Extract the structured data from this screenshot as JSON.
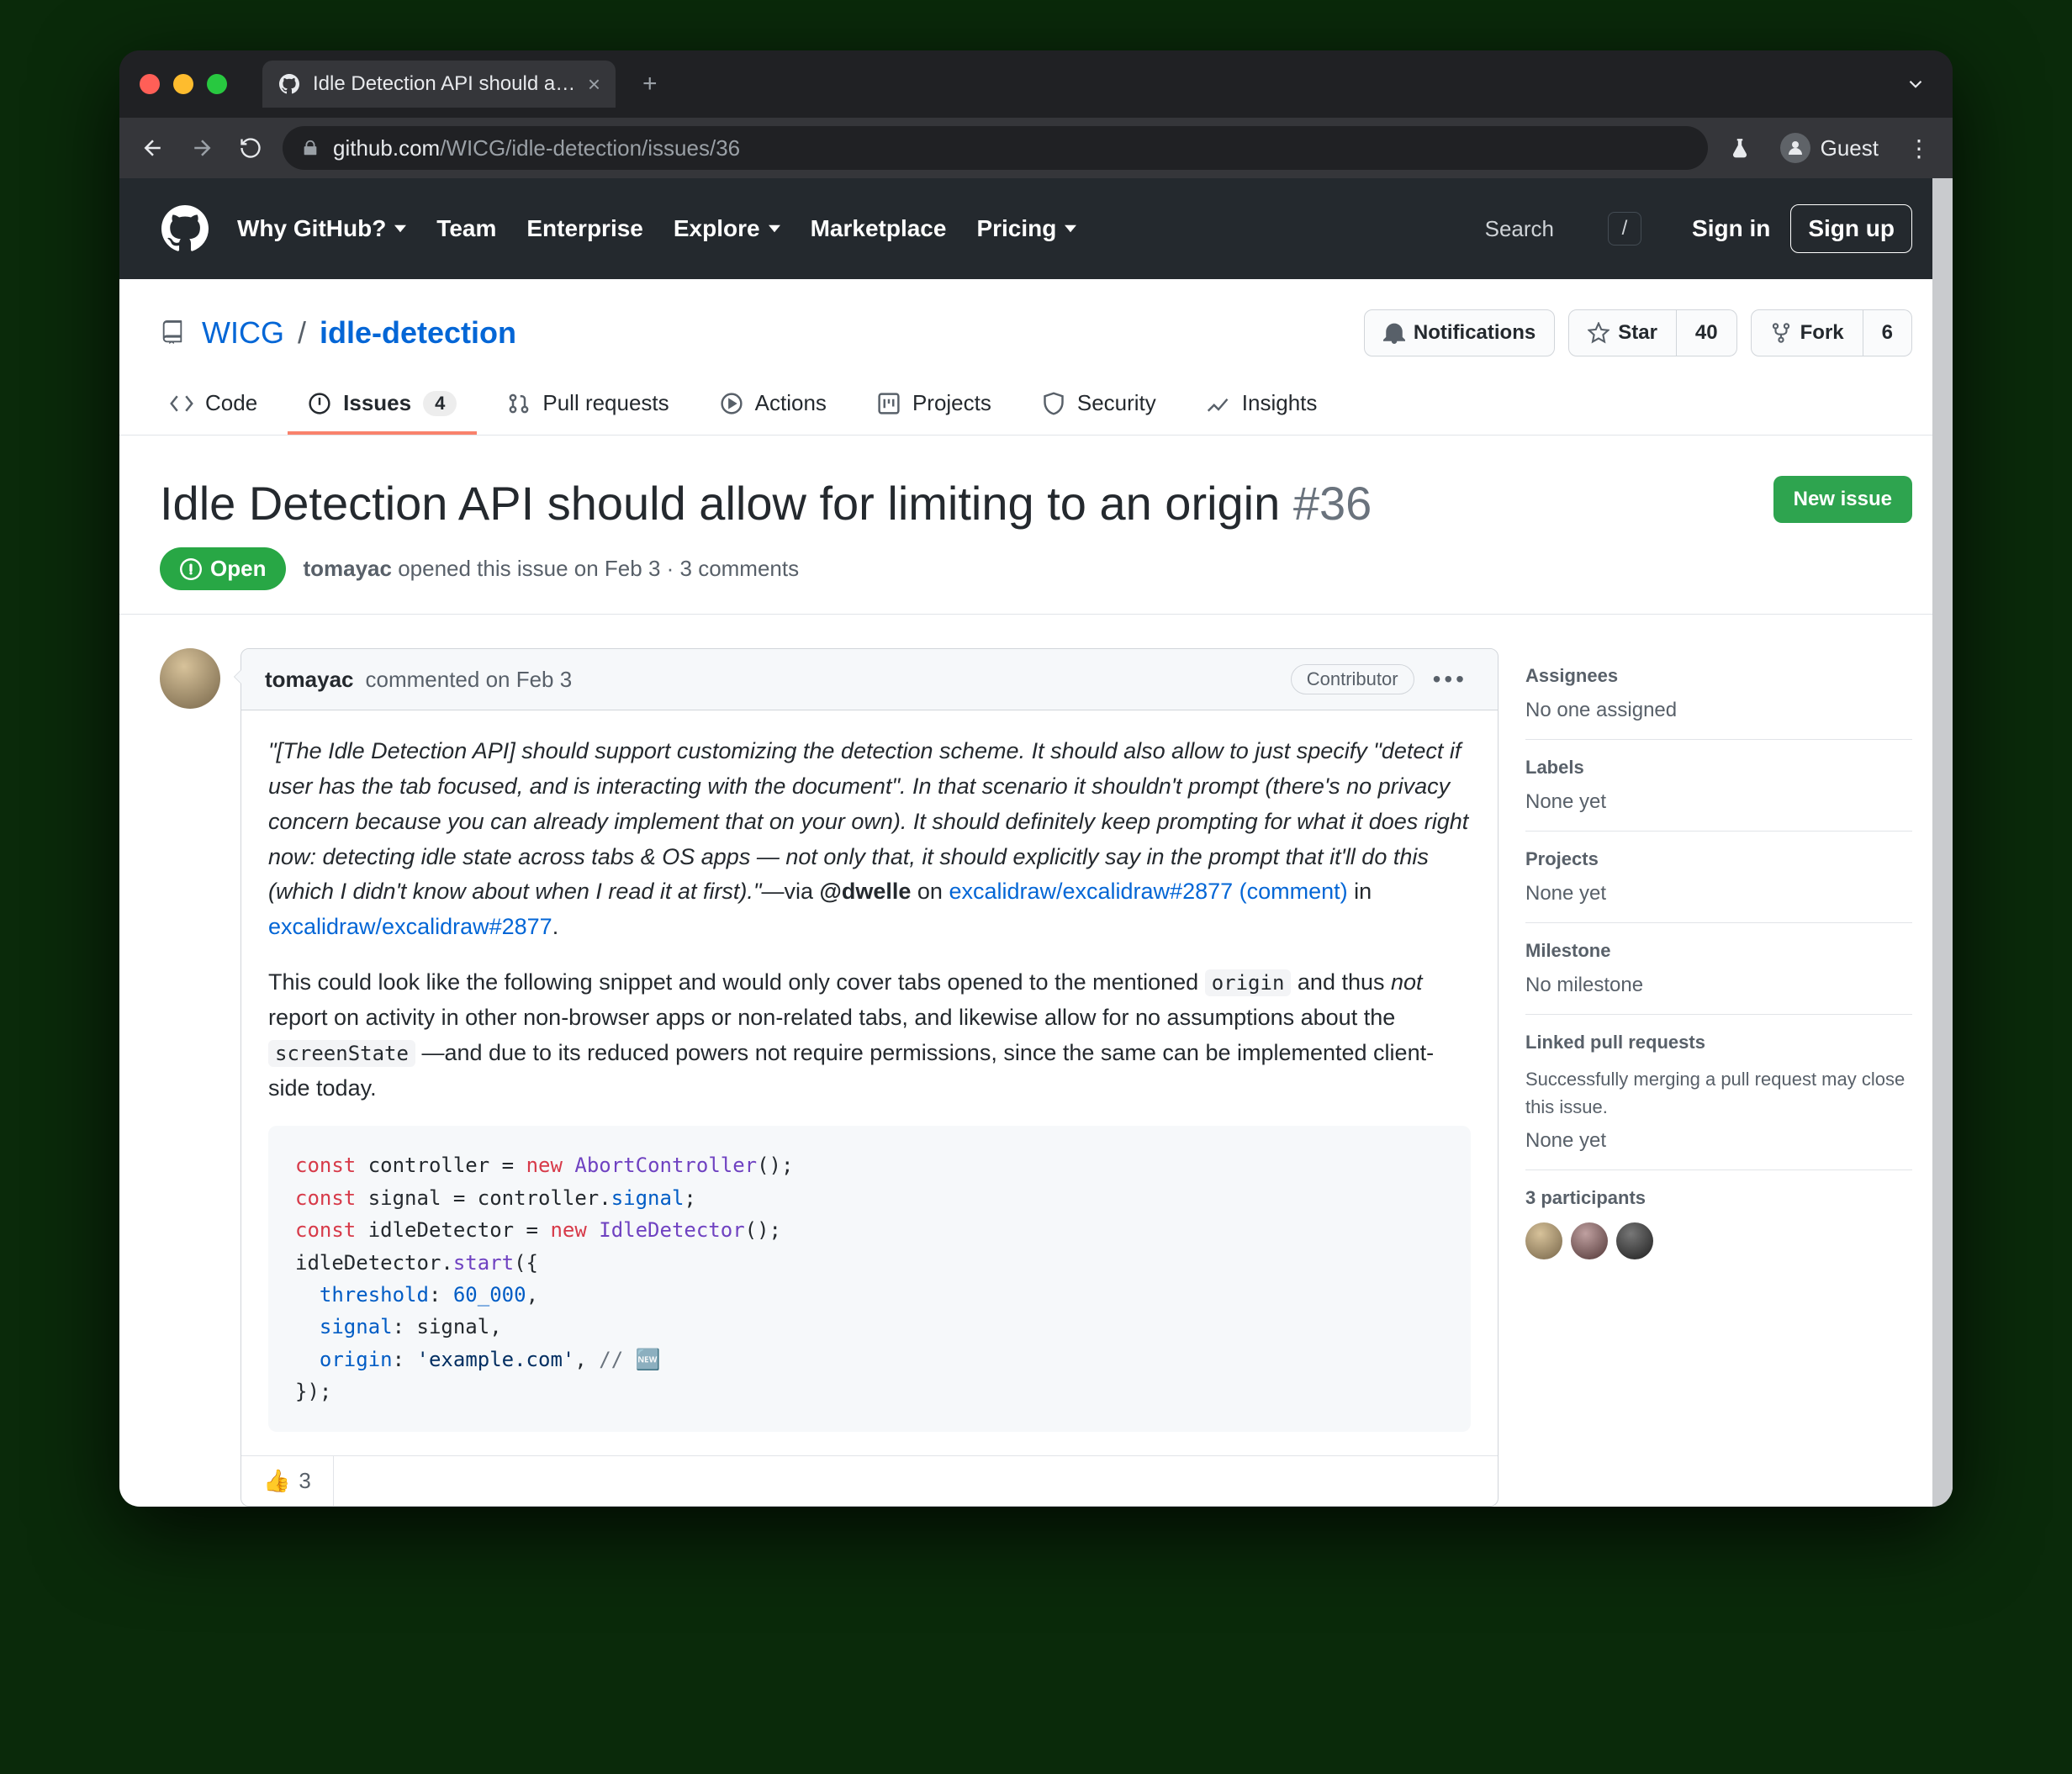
{
  "browser": {
    "tab_title": "Idle Detection API should allow",
    "url_host": "github.com",
    "url_path": "/WICG/idle-detection/issues/36",
    "profile_label": "Guest"
  },
  "gh_nav": {
    "why": "Why GitHub?",
    "team": "Team",
    "enterprise": "Enterprise",
    "explore": "Explore",
    "marketplace": "Marketplace",
    "pricing": "Pricing",
    "search_placeholder": "Search",
    "slash": "/",
    "signin": "Sign in",
    "signup": "Sign up"
  },
  "repo": {
    "owner": "WICG",
    "name": "idle-detection",
    "actions": {
      "notifications": "Notifications",
      "star": "Star",
      "star_count": "40",
      "fork": "Fork",
      "fork_count": "6"
    },
    "tabs": {
      "code": "Code",
      "issues": "Issues",
      "issues_count": "4",
      "pulls": "Pull requests",
      "actions": "Actions",
      "projects": "Projects",
      "security": "Security",
      "insights": "Insights"
    }
  },
  "issue": {
    "title": "Idle Detection API should allow for limiting to an origin",
    "number": "#36",
    "new_button": "New issue",
    "state": "Open",
    "author": "tomayac",
    "opened_text": "opened this issue on Feb 3 · 3 comments"
  },
  "comment": {
    "author": "tomayac",
    "meta": "commented on Feb 3",
    "badge": "Contributor",
    "quote": "\"[The Idle Detection API] should support customizing the detection scheme. It should also allow to just specify \"detect if user has the tab focused, and is interacting with the document\". In that scenario it shouldn't prompt (there's no privacy concern because you can already implement that on your own). It should definitely keep prompting for what it does right now: detecting idle state across tabs & OS apps — not only that, it should explicitly say in the prompt that it'll do this (which I didn't know about when I read it at first).\"",
    "via_prefix": "—via ",
    "via_handle": "@dwelle",
    "via_on": " on ",
    "link1": "excalidraw/excalidraw#2877 (comment)",
    "via_in": " in ",
    "link2": "excalidraw/excalidraw#2877",
    "p2a": "This could look like the following snippet and would only cover tabs opened to the mentioned ",
    "code_origin": "origin",
    "p2b": " and thus ",
    "not": "not",
    "p2c": " report on activity in other non-browser apps or non-related tabs, and likewise allow for no assumptions about the ",
    "code_screen": "screenState",
    "p2d": " —and due to its reduced powers not require permissions, since the same can be implemented client-side today.",
    "code": {
      "l1_kw1": "const",
      "l1_id": "controller",
      "l1_eq": " = ",
      "l1_kw2": "new",
      "l1_fn": " AbortController",
      "l1_tail": "();",
      "l2_kw": "const",
      "l2_id": "signal",
      "l2_eq": " = controller.",
      "l2_prop": "signal",
      "l2_tail": ";",
      "l3_kw1": "const",
      "l3_id": "idleDetector",
      "l3_eq": " = ",
      "l3_kw2": "new",
      "l3_fn": " IdleDetector",
      "l3_tail": "();",
      "l4_a": "idleDetector.",
      "l4_fn": "start",
      "l4_b": "({",
      "l5_key": "threshold",
      "l5_sep": ": ",
      "l5_val": "60_000",
      "l5_tail": ",",
      "l6_key": "signal",
      "l6_sep": ": signal,",
      "l7_key": "origin",
      "l7_sep": ": ",
      "l7_val": "'example.com'",
      "l7_tail": ", ",
      "l7_cm": "// 🆕",
      "l8": "});"
    },
    "reaction_emoji": "👍",
    "reaction_count": "3"
  },
  "sidebar": {
    "assignees_h": "Assignees",
    "assignees_v": "No one assigned",
    "labels_h": "Labels",
    "labels_v": "None yet",
    "projects_h": "Projects",
    "projects_v": "None yet",
    "milestone_h": "Milestone",
    "milestone_v": "No milestone",
    "linked_h": "Linked pull requests",
    "linked_desc": "Successfully merging a pull request may close this issue.",
    "linked_v": "None yet",
    "participants_h": "3 participants"
  }
}
